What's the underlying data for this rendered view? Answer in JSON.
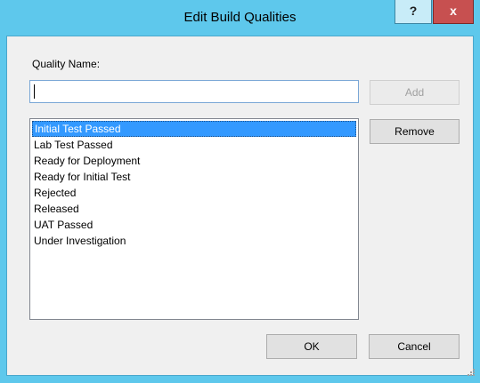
{
  "window": {
    "title": "Edit Build Qualities",
    "help_label": "?",
    "close_label": "x"
  },
  "form": {
    "quality_name_label": "Quality Name:",
    "quality_name_value": "",
    "add_label": "Add",
    "remove_label": "Remove",
    "ok_label": "OK",
    "cancel_label": "Cancel"
  },
  "qualities": [
    "Initial Test Passed",
    "Lab Test Passed",
    "Ready for Deployment",
    "Ready for Initial Test",
    "Rejected",
    "Released",
    "UAT Passed",
    "Under Investigation"
  ],
  "selected_index": 0,
  "colors": {
    "titlebar": "#5ec8ec",
    "close_button": "#c75050",
    "selection": "#3399ff"
  }
}
